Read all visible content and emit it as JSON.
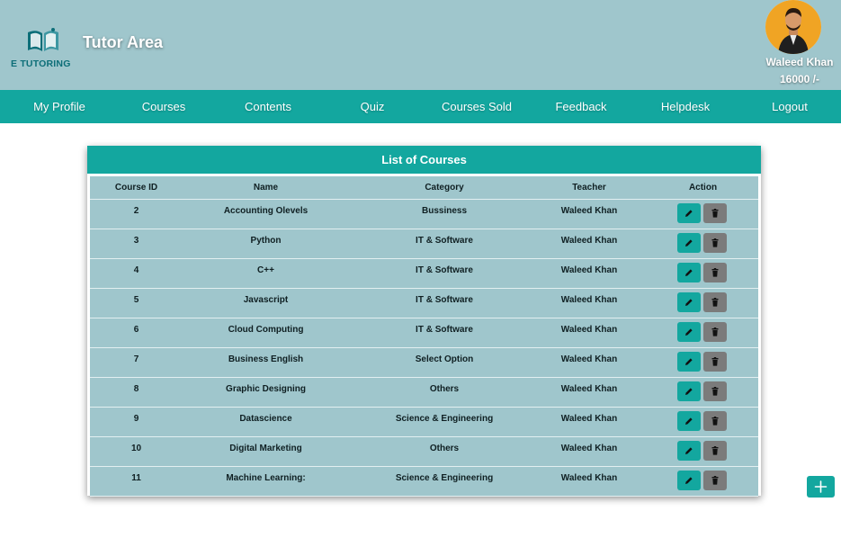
{
  "header": {
    "logo_text": "E TUTORING",
    "title": "Tutor Area",
    "user_name": "Waleed Khan",
    "balance": "16000 /-"
  },
  "nav": {
    "items": [
      "My Profile",
      "Courses",
      "Contents",
      "Quiz",
      "Courses Sold",
      "Feedback",
      "Helpdesk",
      "Logout"
    ]
  },
  "courses_panel": {
    "title": "List of Courses",
    "columns": [
      "Course ID",
      "Name",
      "Category",
      "Teacher",
      "Action"
    ],
    "rows": [
      {
        "id": "2",
        "name": "Accounting Olevels",
        "category": "Bussiness",
        "teacher": "Waleed Khan"
      },
      {
        "id": "3",
        "name": "Python",
        "category": "IT & Software",
        "teacher": "Waleed Khan"
      },
      {
        "id": "4",
        "name": "C++",
        "category": "IT & Software",
        "teacher": "Waleed Khan"
      },
      {
        "id": "5",
        "name": "Javascript",
        "category": "IT & Software",
        "teacher": "Waleed Khan"
      },
      {
        "id": "6",
        "name": "Cloud Computing",
        "category": "IT & Software",
        "teacher": "Waleed Khan"
      },
      {
        "id": "7",
        "name": "Business English",
        "category": "Select Option",
        "teacher": "Waleed Khan"
      },
      {
        "id": "8",
        "name": "Graphic Designing",
        "category": "Others",
        "teacher": "Waleed Khan"
      },
      {
        "id": "9",
        "name": "Datascience",
        "category": "Science & Engineering",
        "teacher": "Waleed Khan"
      },
      {
        "id": "10",
        "name": "Digital Marketing",
        "category": "Others",
        "teacher": "Waleed Khan"
      },
      {
        "id": "11",
        "name": "Machine Learning:",
        "category": "Science & Engineering",
        "teacher": "Waleed Khan"
      }
    ]
  },
  "icons": {
    "edit": "pencil-icon",
    "delete": "trash-icon",
    "add": "plus-icon"
  },
  "colors": {
    "header_bg": "#9fc6cc",
    "accent": "#13a79f",
    "delete_button": "#7b7b7b",
    "avatar_bg": "#f0a424"
  }
}
